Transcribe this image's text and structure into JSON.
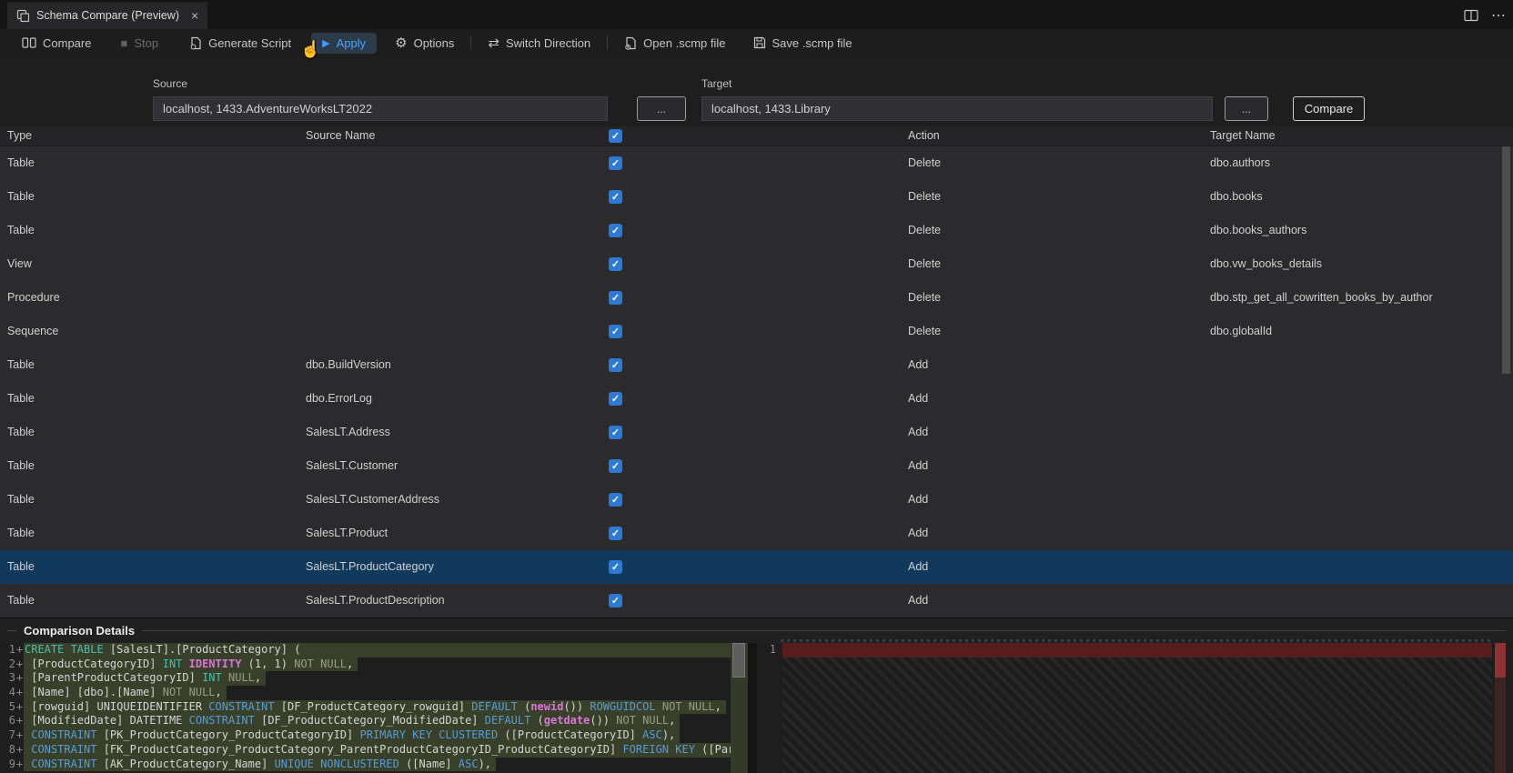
{
  "tab": {
    "title": "Schema Compare (Preview)"
  },
  "icons": {
    "close": "×",
    "more": "⋯",
    "gear": "⚙",
    "switch": "⇄",
    "play": "▶",
    "stop": "■",
    "check": "✓",
    "cursor": "☝"
  },
  "toolbar": {
    "compare": "Compare",
    "stop": "Stop",
    "generate_script": "Generate Script",
    "apply": "Apply",
    "options": "Options",
    "switch_direction": "Switch Direction",
    "open_scmp": "Open .scmp file",
    "save_scmp": "Save .scmp file"
  },
  "connection": {
    "source_label": "Source",
    "source_value": "localhost, 1433.AdventureWorksLT2022",
    "target_label": "Target",
    "target_value": "localhost, 1433.Library",
    "browse": "...",
    "compare": "Compare"
  },
  "grid": {
    "columns": [
      "Type",
      "Source Name",
      "Action",
      "Target Name"
    ],
    "rows": [
      {
        "type": "Table",
        "source": "",
        "action": "Delete",
        "target": "dbo.authors",
        "checked": true,
        "selected": false
      },
      {
        "type": "Table",
        "source": "",
        "action": "Delete",
        "target": "dbo.books",
        "checked": true,
        "selected": false
      },
      {
        "type": "Table",
        "source": "",
        "action": "Delete",
        "target": "dbo.books_authors",
        "checked": true,
        "selected": false
      },
      {
        "type": "View",
        "source": "",
        "action": "Delete",
        "target": "dbo.vw_books_details",
        "checked": true,
        "selected": false
      },
      {
        "type": "Procedure",
        "source": "",
        "action": "Delete",
        "target": "dbo.stp_get_all_cowritten_books_by_author",
        "checked": true,
        "selected": false
      },
      {
        "type": "Sequence",
        "source": "",
        "action": "Delete",
        "target": "dbo.globalId",
        "checked": true,
        "selected": false
      },
      {
        "type": "Table",
        "source": "dbo.BuildVersion",
        "action": "Add",
        "target": "",
        "checked": true,
        "selected": false
      },
      {
        "type": "Table",
        "source": "dbo.ErrorLog",
        "action": "Add",
        "target": "",
        "checked": true,
        "selected": false
      },
      {
        "type": "Table",
        "source": "SalesLT.Address",
        "action": "Add",
        "target": "",
        "checked": true,
        "selected": false
      },
      {
        "type": "Table",
        "source": "SalesLT.Customer",
        "action": "Add",
        "target": "",
        "checked": true,
        "selected": false
      },
      {
        "type": "Table",
        "source": "SalesLT.CustomerAddress",
        "action": "Add",
        "target": "",
        "checked": true,
        "selected": false
      },
      {
        "type": "Table",
        "source": "SalesLT.Product",
        "action": "Add",
        "target": "",
        "checked": true,
        "selected": false
      },
      {
        "type": "Table",
        "source": "SalesLT.ProductCategory",
        "action": "Add",
        "target": "",
        "checked": true,
        "selected": true
      },
      {
        "type": "Table",
        "source": "SalesLT.ProductDescription",
        "action": "Add",
        "target": "",
        "checked": true,
        "selected": false
      }
    ]
  },
  "details": {
    "title": "Comparison Details",
    "right_line_number": "1",
    "left_lines": [
      {
        "num": "1",
        "sign": "+",
        "full": true,
        "tokens": [
          [
            "t-type",
            "CREATE TABLE"
          ],
          [
            "t-id",
            " [SalesLT].[ProductCategory] ("
          ]
        ]
      },
      {
        "num": "2",
        "sign": "+",
        "full": false,
        "tokens": [
          [
            "t-id",
            " [ProductCategoryID] "
          ],
          [
            "t-type",
            "INT"
          ],
          [
            "t-id",
            " "
          ],
          [
            "t-fn",
            "IDENTITY"
          ],
          [
            "t-id",
            " (1, 1) "
          ],
          [
            "t-gr",
            "NOT NULL"
          ],
          [
            "t-id",
            ","
          ]
        ]
      },
      {
        "num": "3",
        "sign": "+",
        "full": false,
        "tokens": [
          [
            "t-id",
            " [ParentProductCategoryID] "
          ],
          [
            "t-type",
            "INT"
          ],
          [
            "t-id",
            " "
          ],
          [
            "t-gr",
            "NULL"
          ],
          [
            "t-id",
            ","
          ]
        ]
      },
      {
        "num": "4",
        "sign": "+",
        "full": false,
        "tokens": [
          [
            "t-id",
            " [Name] [dbo].[Name] "
          ],
          [
            "t-gr",
            "NOT NULL"
          ],
          [
            "t-id",
            ","
          ]
        ]
      },
      {
        "num": "5",
        "sign": "+",
        "full": false,
        "tokens": [
          [
            "t-id",
            " [rowguid] UNIQUEIDENTIFIER "
          ],
          [
            "t-kw",
            "CONSTRAINT"
          ],
          [
            "t-id",
            " [DF_ProductCategory_rowguid] "
          ],
          [
            "t-kw",
            "DEFAULT"
          ],
          [
            "t-id",
            " ("
          ],
          [
            "t-fn",
            "newid"
          ],
          [
            "t-id",
            "()) "
          ],
          [
            "t-kw",
            "ROWGUIDCOL"
          ],
          [
            "t-id",
            " "
          ],
          [
            "t-gr",
            "NOT NULL"
          ],
          [
            "t-id",
            ","
          ]
        ]
      },
      {
        "num": "6",
        "sign": "+",
        "full": false,
        "tokens": [
          [
            "t-id",
            " [ModifiedDate] DATETIME "
          ],
          [
            "t-kw",
            "CONSTRAINT"
          ],
          [
            "t-id",
            " [DF_ProductCategory_ModifiedDate] "
          ],
          [
            "t-kw",
            "DEFAULT"
          ],
          [
            "t-id",
            " ("
          ],
          [
            "t-fn",
            "getdate"
          ],
          [
            "t-id",
            "()) "
          ],
          [
            "t-gr",
            "NOT NULL"
          ],
          [
            "t-id",
            ","
          ]
        ]
      },
      {
        "num": "7",
        "sign": "+",
        "full": false,
        "tokens": [
          [
            "t-id",
            " "
          ],
          [
            "t-kw",
            "CONSTRAINT"
          ],
          [
            "t-id",
            " [PK_ProductCategory_ProductCategoryID] "
          ],
          [
            "t-kw",
            "PRIMARY KEY CLUSTERED"
          ],
          [
            "t-id",
            " ([ProductCategoryID] "
          ],
          [
            "t-kw",
            "ASC"
          ],
          [
            "t-id",
            "),"
          ]
        ]
      },
      {
        "num": "8",
        "sign": "+",
        "full": false,
        "tokens": [
          [
            "t-id",
            " "
          ],
          [
            "t-kw",
            "CONSTRAINT"
          ],
          [
            "t-id",
            " [FK_ProductCategory_ProductCategory_ParentProductCategoryID_ProductCategoryID] "
          ],
          [
            "t-kw",
            "FOREIGN KEY"
          ],
          [
            "t-id",
            " ([ParentProductCategoryID] "
          ]
        ]
      },
      {
        "num": "9",
        "sign": "+",
        "full": false,
        "tokens": [
          [
            "t-id",
            " "
          ],
          [
            "t-kw",
            "CONSTRAINT"
          ],
          [
            "t-id",
            " [AK_ProductCategory_Name] "
          ],
          [
            "t-kw",
            "UNIQUE NONCLUSTERED"
          ],
          [
            "t-id",
            " ([Name] "
          ],
          [
            "t-kw",
            "ASC"
          ],
          [
            "t-id",
            "),"
          ]
        ]
      }
    ]
  },
  "colors": {
    "checkbox_blue": "#2b7bd4",
    "selection_blue": "#11395c",
    "added_line_bg": "#39402a",
    "removed_line_bg": "#571d1d",
    "apply_blue": "#4da3ff"
  }
}
